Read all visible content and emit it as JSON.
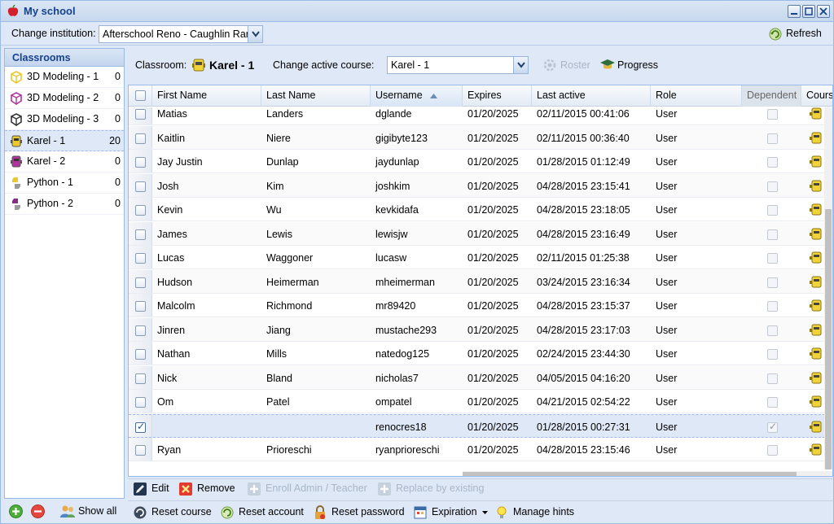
{
  "window": {
    "title": "My school"
  },
  "institution": {
    "label": "Change institution:",
    "value": "Afterschool Reno - Caughlin Ranch"
  },
  "refresh_label": "Refresh",
  "classrooms": {
    "header": "Classrooms",
    "items": [
      {
        "label": "3D Modeling - 1",
        "count": "0",
        "icon": "3d-modeling-icon",
        "color": "#e8c82a"
      },
      {
        "label": "3D Modeling - 2",
        "count": "0",
        "icon": "3d-modeling-icon",
        "color": "#b0359a"
      },
      {
        "label": "3D Modeling - 3",
        "count": "0",
        "icon": "3d-modeling-icon",
        "color": "#333333"
      },
      {
        "label": "Karel - 1",
        "count": "20",
        "icon": "karel-robot-icon",
        "color": "#e8c82a"
      },
      {
        "label": "Karel - 2",
        "count": "0",
        "icon": "karel-robot-icon",
        "color": "#b0359a"
      },
      {
        "label": "Python - 1",
        "count": "0",
        "icon": "python-icon",
        "color": "#e8c82a"
      },
      {
        "label": "Python - 2",
        "count": "0",
        "icon": "python-icon",
        "color": "#8a2a8a"
      }
    ],
    "selected_index": 3,
    "show_all": "Show all"
  },
  "classbar": {
    "classroom_label": "Classroom:",
    "classroom_name": "Karel - 1",
    "change_course_label": "Change active course:",
    "course_value": "Karel - 1",
    "roster": "Roster",
    "progress": "Progress"
  },
  "grid": {
    "columns": [
      "First Name",
      "Last Name",
      "Username",
      "Expires",
      "Last active",
      "Role",
      "Dependent",
      "Cours"
    ],
    "sorted_column": "Username",
    "rows": [
      {
        "first": "Matias",
        "last": "Landers",
        "user": "dglande",
        "expires": "01/20/2025",
        "active": "02/11/2015 00:41:06",
        "role": "User",
        "selected": false,
        "dependent": false
      },
      {
        "first": "Kaitlin",
        "last": "Niere",
        "user": "gigibyte123",
        "expires": "01/20/2025",
        "active": "02/11/2015 00:36:40",
        "role": "User",
        "selected": false,
        "dependent": false
      },
      {
        "first": "Jay Justin",
        "last": "Dunlap",
        "user": "jaydunlap",
        "expires": "01/20/2025",
        "active": "01/28/2015 01:12:49",
        "role": "User",
        "selected": false,
        "dependent": false
      },
      {
        "first": "Josh",
        "last": "Kim",
        "user": "joshkim",
        "expires": "01/20/2025",
        "active": "04/28/2015 23:15:41",
        "role": "User",
        "selected": false,
        "dependent": false
      },
      {
        "first": "Kevin",
        "last": "Wu",
        "user": "kevkidafa",
        "expires": "01/20/2025",
        "active": "04/28/2015 23:18:05",
        "role": "User",
        "selected": false,
        "dependent": false
      },
      {
        "first": "James",
        "last": "Lewis",
        "user": "lewisjw",
        "expires": "01/20/2025",
        "active": "04/28/2015 23:16:49",
        "role": "User",
        "selected": false,
        "dependent": false
      },
      {
        "first": "Lucas",
        "last": "Waggoner",
        "user": "lucasw",
        "expires": "01/20/2025",
        "active": "02/11/2015 01:25:38",
        "role": "User",
        "selected": false,
        "dependent": false
      },
      {
        "first": "Hudson",
        "last": "Heimerman",
        "user": "mheimerman",
        "expires": "01/20/2025",
        "active": "03/24/2015 23:16:34",
        "role": "User",
        "selected": false,
        "dependent": false
      },
      {
        "first": "Malcolm",
        "last": "Richmond",
        "user": "mr89420",
        "expires": "01/20/2025",
        "active": "04/28/2015 23:15:37",
        "role": "User",
        "selected": false,
        "dependent": false
      },
      {
        "first": "Jinren",
        "last": "Jiang",
        "user": "mustache293",
        "expires": "01/20/2025",
        "active": "04/28/2015 23:17:03",
        "role": "User",
        "selected": false,
        "dependent": false
      },
      {
        "first": "Nathan",
        "last": "Mills",
        "user": "natedog125",
        "expires": "01/20/2025",
        "active": "02/24/2015 23:44:30",
        "role": "User",
        "selected": false,
        "dependent": false
      },
      {
        "first": "Nick",
        "last": "Bland",
        "user": "nicholas7",
        "expires": "01/20/2025",
        "active": "04/05/2015 04:16:20",
        "role": "User",
        "selected": false,
        "dependent": false
      },
      {
        "first": "Om",
        "last": "Patel",
        "user": "ompatel",
        "expires": "01/20/2025",
        "active": "04/21/2015 02:54:22",
        "role": "User",
        "selected": false,
        "dependent": false
      },
      {
        "first": "",
        "last": "",
        "user": "renocres18",
        "expires": "01/20/2025",
        "active": "01/28/2015 00:27:31",
        "role": "User",
        "selected": true,
        "dependent": true
      },
      {
        "first": "Ryan",
        "last": "Prioreschi",
        "user": "ryanprioreschi",
        "expires": "01/20/2025",
        "active": "04/28/2015 23:15:46",
        "role": "User",
        "selected": false,
        "dependent": false
      }
    ]
  },
  "actions": {
    "edit": "Edit",
    "remove": "Remove",
    "enroll": "Enroll Admin / Teacher",
    "replace": "Replace by existing"
  },
  "bottom": {
    "reset_course": "Reset course",
    "reset_account": "Reset account",
    "reset_password": "Reset password",
    "expiration": "Expiration",
    "manage_hints": "Manage hints"
  }
}
